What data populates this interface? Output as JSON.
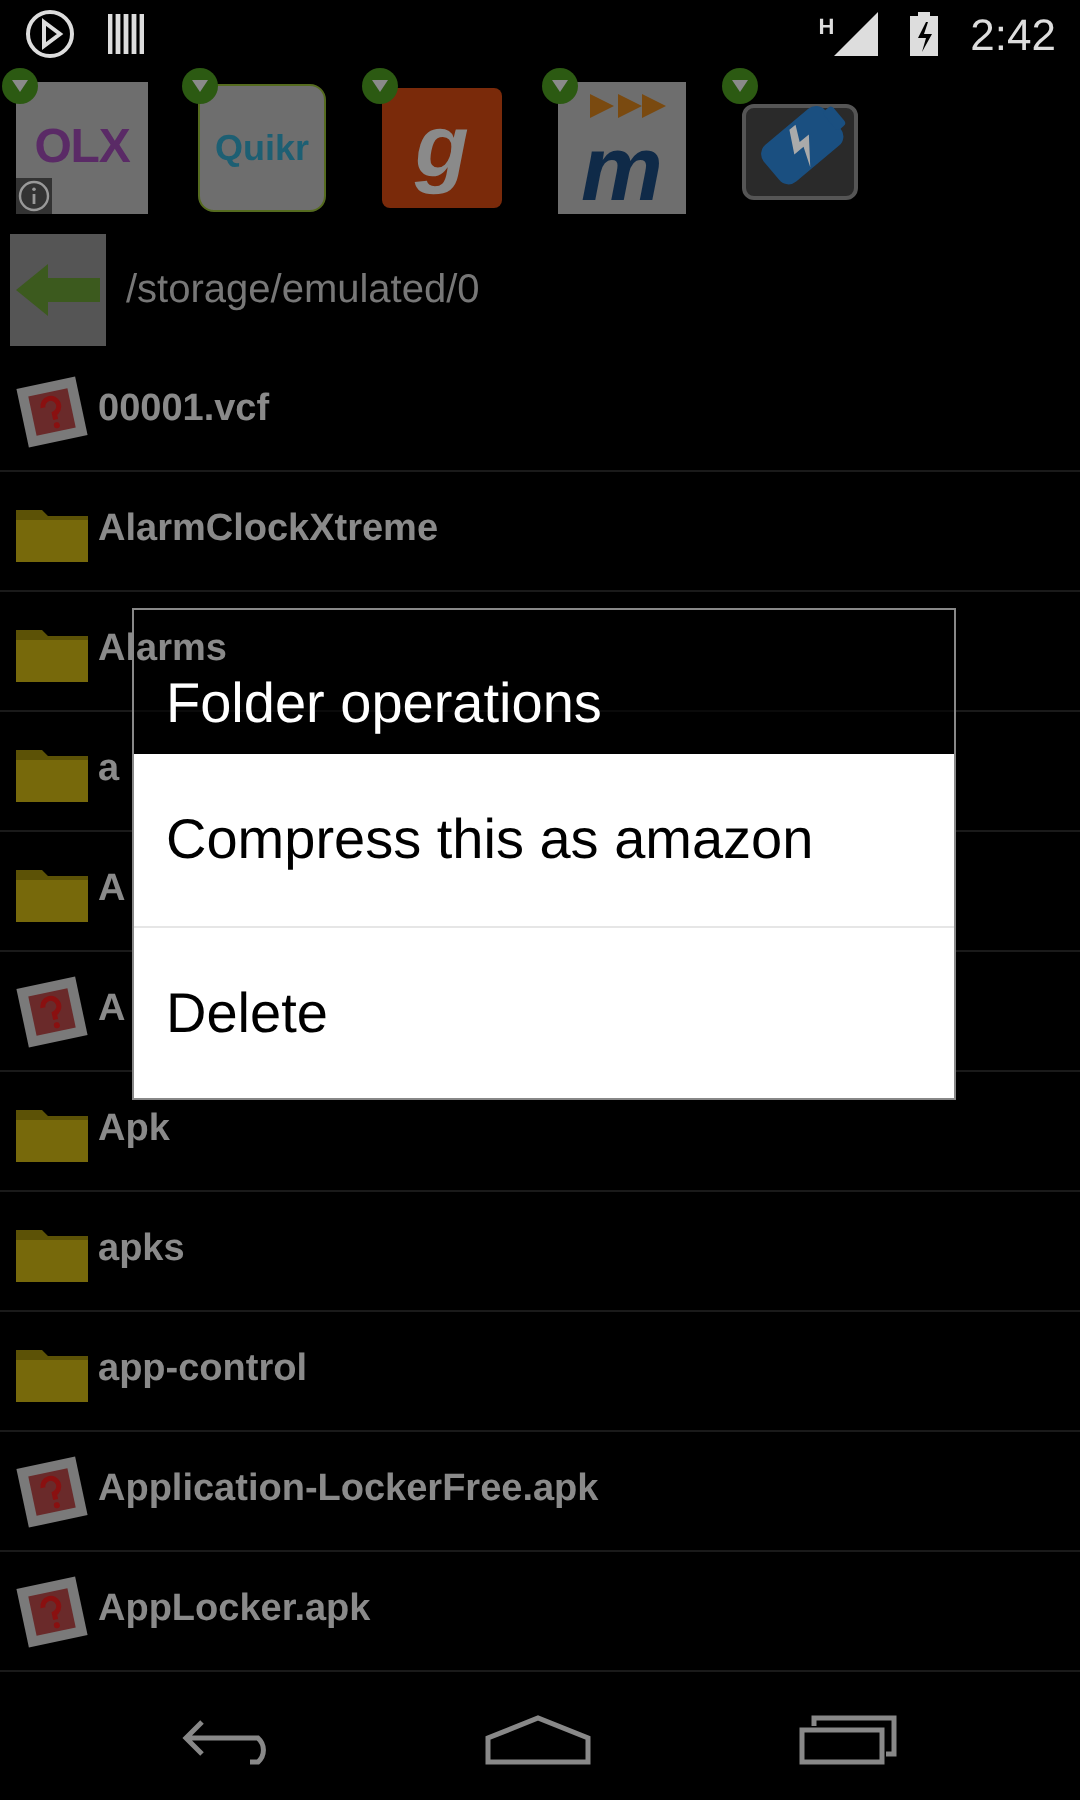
{
  "status_bar": {
    "network": "H",
    "time": "2:42"
  },
  "apps": [
    {
      "kind": "olx",
      "label": "OLX"
    },
    {
      "kind": "quikr",
      "label": "Quikr"
    },
    {
      "kind": "g",
      "label": "g"
    },
    {
      "kind": "m",
      "label": "m"
    },
    {
      "kind": "battery"
    }
  ],
  "path": "/storage/emulated/0",
  "files": [
    {
      "kind": "unknown",
      "name": "00001.vcf"
    },
    {
      "kind": "folder",
      "name": "AlarmClockXtreme"
    },
    {
      "kind": "folder",
      "name": "Alarms"
    },
    {
      "kind": "folder",
      "name": "a"
    },
    {
      "kind": "folder",
      "name": "A"
    },
    {
      "kind": "unknown",
      "name": "A"
    },
    {
      "kind": "folder",
      "name": "Apk"
    },
    {
      "kind": "folder",
      "name": "apks"
    },
    {
      "kind": "folder",
      "name": "app-control"
    },
    {
      "kind": "unknown",
      "name": "Application-LockerFree.apk"
    },
    {
      "kind": "unknown",
      "name": "AppLocker.apk"
    }
  ],
  "dialog": {
    "title": "Folder operations",
    "items": [
      "Compress this as amazon",
      "Delete"
    ]
  }
}
